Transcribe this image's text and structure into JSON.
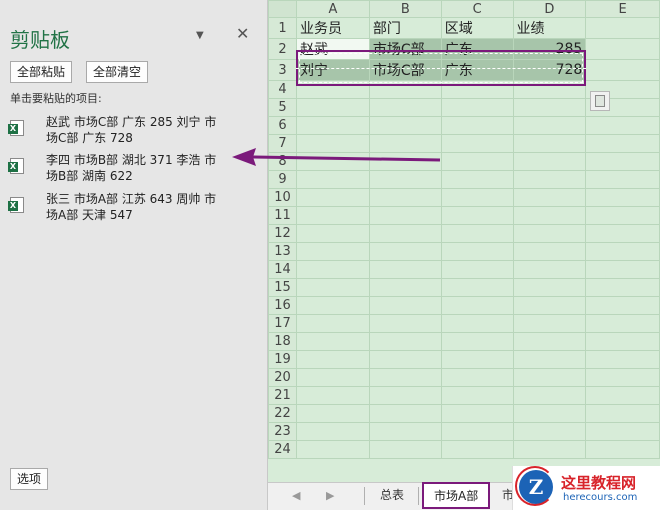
{
  "clipboard": {
    "title": "剪贴板",
    "menu_glyph": "▼",
    "close_glyph": "✕",
    "paste_all_label": "全部粘贴",
    "clear_all_label": "全部清空",
    "hint": "单击要粘贴的项目:",
    "items": [
      {
        "line1": "赵武 市场C部 广东 285 刘宁 市",
        "line2": "场C部 广东 728",
        "icon": "excel-file-icon"
      },
      {
        "line1": "李四 市场B部 湖北 371 李浩 市",
        "line2": "场B部 湖南 622",
        "icon": "excel-file-icon"
      },
      {
        "line1": "张三 市场A部 江苏 643 周帅 市",
        "line2": "场A部 天津 547",
        "icon": "excel-file-icon"
      }
    ],
    "options_label": "选项"
  },
  "sheet": {
    "columns": [
      "A",
      "B",
      "C",
      "D",
      "E"
    ],
    "rows": [
      "1",
      "2",
      "3",
      "4",
      "5",
      "6",
      "7",
      "8",
      "9",
      "10",
      "11",
      "12",
      "13",
      "14",
      "15",
      "16",
      "17",
      "18",
      "19",
      "20",
      "21",
      "22",
      "23",
      "24"
    ],
    "header_row": [
      "业务员",
      "部门",
      "区域",
      "业绩"
    ],
    "data": [
      [
        "赵武",
        "市场C部",
        "广东",
        "285"
      ],
      [
        "刘宁",
        "市场C部",
        "广东",
        "728"
      ]
    ]
  },
  "tabs": {
    "prev": "◀",
    "next": "▶",
    "items": [
      "总表",
      "市场A部",
      "市"
    ]
  },
  "colors": {
    "accent_purple": "#7b1a7b",
    "excel_green": "#217346",
    "sheet_bg": "#d7ecd8"
  },
  "watermark": {
    "logo_letter": "Z",
    "title": "这里教程网",
    "url": "herecours.com"
  }
}
